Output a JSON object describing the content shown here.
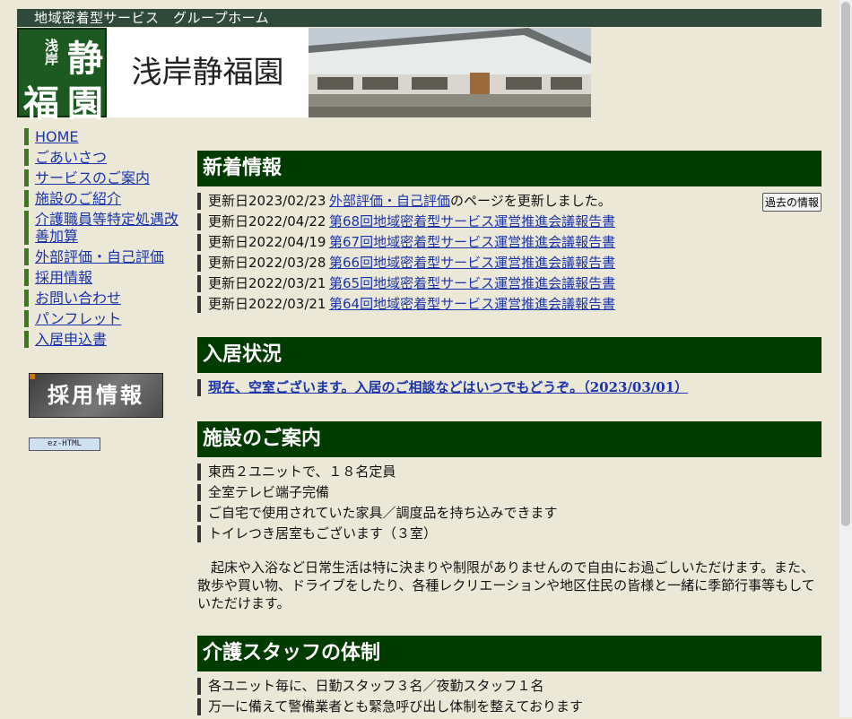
{
  "topbar": {
    "text": "地域密着型サービス　グループホーム"
  },
  "header": {
    "logo_chars": [
      "浅岸",
      "静",
      "福",
      "園"
    ],
    "title": "浅岸静福園"
  },
  "sidebar": {
    "items": [
      "HOME",
      "ごあいさつ",
      "サービスのご案内",
      "施設のご紹介",
      "介護職員等特定処遇改善加算",
      "外部評価・自己評価",
      "採用情報",
      "お問い合わせ",
      "パンフレット",
      "入居申込書"
    ],
    "recruit_banner": "採用情報",
    "ez_badge": "ez-HTML"
  },
  "news": {
    "heading": "新着情報",
    "past_button": "過去の情報",
    "items": [
      {
        "date": "更新日2023/02/23",
        "link": "外部評価・自己評価",
        "suffix": "のページを更新しました。"
      },
      {
        "date": "更新日2022/04/22",
        "link": "第68回地域密着型サービス運営推進会議報告書",
        "suffix": ""
      },
      {
        "date": "更新日2022/04/19",
        "link": "第67回地域密着型サービス運営推進会議報告書",
        "suffix": ""
      },
      {
        "date": "更新日2022/03/28",
        "link": "第66回地域密着型サービス運営推進会議報告書",
        "suffix": ""
      },
      {
        "date": "更新日2022/03/21",
        "link": "第65回地域密着型サービス運営推進会議報告書",
        "suffix": ""
      },
      {
        "date": "更新日2022/03/21",
        "link": "第64回地域密着型サービス運営推進会議報告書",
        "suffix": ""
      }
    ]
  },
  "occupancy": {
    "heading": "入居状況",
    "text": "現在、空室ございます。入居のご相談などはいつでもどうぞ。（2023/03/01）"
  },
  "facility": {
    "heading": "施設のご案内",
    "items": [
      "東西２ユニットで、１８名定員",
      "全室テレビ端子完備",
      "ご自宅で使用されていた家具／調度品を持ち込みできます",
      "トイレつき居室もございます（３室）"
    ],
    "paragraph": "　起床や入浴など日常生活は特に決まりや制限がありませんので自由にお過ごしいただけます。また、散歩や買い物、ドライブをしたり、各種レクリエーションや地区住民の皆様と一緒に季節行事等もしていただけます。"
  },
  "staff": {
    "heading": "介護スタッフの体制",
    "items": [
      "各ユニット毎に、日勤スタッフ３名／夜勤スタッフ１名",
      "万一に備えて警備業者とも緊急呼び出し体制を整えております"
    ]
  }
}
